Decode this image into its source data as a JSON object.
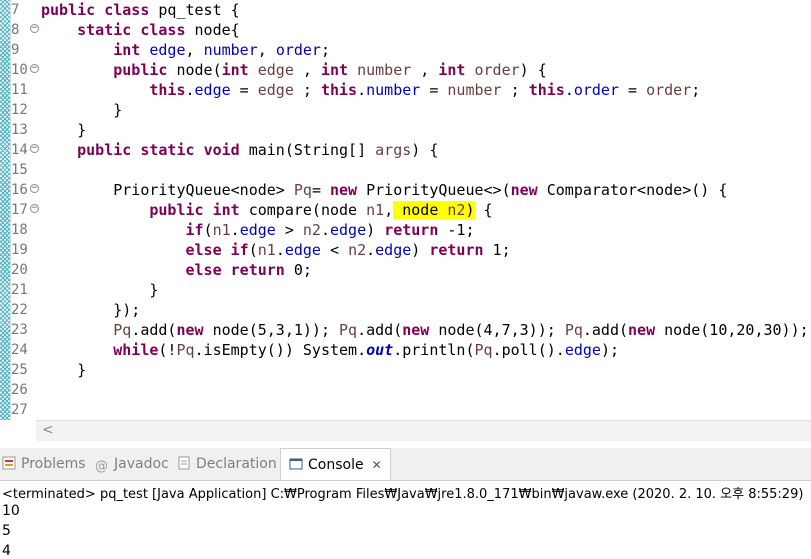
{
  "editor": {
    "lines": [
      {
        "num": "7",
        "fold": "",
        "html": "<span class=\"kw\">public</span> <span class=\"kw\">class</span> pq_test {"
      },
      {
        "num": "8",
        "fold": "⊖",
        "html": "    <span class=\"kw\">static</span> <span class=\"kw\">class</span> node{"
      },
      {
        "num": "9",
        "fold": "",
        "html": "        <span class=\"kw\">int</span> <span class=\"fld\">edge</span>, <span class=\"fld\">number</span>, <span class=\"fld\">order</span>;"
      },
      {
        "num": "10",
        "fold": "⊖",
        "html": "        <span class=\"kw\">public</span> node(<span class=\"kw\">int</span> <span class=\"param\">edge</span> , <span class=\"kw\">int</span> <span class=\"param\">number</span> , <span class=\"kw\">int</span> <span class=\"param\">order</span>) {"
      },
      {
        "num": "11",
        "fold": "",
        "html": "            <span class=\"kw\">this</span>.<span class=\"fld\">edge</span> = <span class=\"param\">edge</span> ; <span class=\"kw\">this</span>.<span class=\"fld\">number</span> = <span class=\"param\">number</span> ; <span class=\"kw\">this</span>.<span class=\"fld\">order</span> = <span class=\"param\">order</span>;"
      },
      {
        "num": "12",
        "fold": "",
        "html": "        }"
      },
      {
        "num": "13",
        "fold": "",
        "html": "    }"
      },
      {
        "num": "14",
        "fold": "⊖",
        "html": "    <span class=\"kw\">public</span> <span class=\"kw\">static</span> <span class=\"kw\">void</span> main(String[] <span class=\"param\">args</span>) {"
      },
      {
        "num": "15",
        "fold": "",
        "html": ""
      },
      {
        "num": "16",
        "fold": "⊖",
        "html": "        PriorityQueue&lt;node&gt; <span class=\"param\">Pq</span>= <span class=\"kw\">new</span> PriorityQueue&lt;&gt;(<span class=\"kw\">new</span> Comparator&lt;node&gt;() {"
      },
      {
        "num": "17",
        "fold": "⊖",
        "html": "            <span class=\"kw\">public</span> <span class=\"kw\">int</span> compare(node <span class=\"param\">n1</span>,<span class=\"hl\"> node <span class=\"param\">n2</span>)</span> {"
      },
      {
        "num": "18",
        "fold": "",
        "html": "                <span class=\"kw\">if</span>(<span class=\"param\">n1</span>.<span class=\"fld\">edge</span> &gt; <span class=\"param\">n2</span>.<span class=\"fld\">edge</span>) <span class=\"kw\">return</span> -1;"
      },
      {
        "num": "19",
        "fold": "",
        "html": "                <span class=\"kw\">else</span> <span class=\"kw\">if</span>(<span class=\"param\">n1</span>.<span class=\"fld\">edge</span> &lt; <span class=\"param\">n2</span>.<span class=\"fld\">edge</span>) <span class=\"kw\">return</span> 1;"
      },
      {
        "num": "20",
        "fold": "",
        "html": "                <span class=\"kw\">else</span> <span class=\"kw\">return</span> 0;"
      },
      {
        "num": "21",
        "fold": "",
        "html": "            }"
      },
      {
        "num": "22",
        "fold": "",
        "html": "        });"
      },
      {
        "num": "23",
        "fold": "",
        "html": "        <span class=\"param\">Pq</span>.add(<span class=\"kw\">new</span> node(5,3,1)); <span class=\"param\">Pq</span>.add(<span class=\"kw\">new</span> node(4,7,3)); <span class=\"param\">Pq</span>.add(<span class=\"kw\">new</span> node(10,20,30));"
      },
      {
        "num": "24",
        "fold": "",
        "html": "        <span class=\"kw\">while</span>(!<span class=\"param\">Pq</span>.isEmpty()) System.<span class=\"stat\">out</span>.println(<span class=\"param\">Pq</span>.poll().<span class=\"fld\">edge</span>);"
      },
      {
        "num": "25",
        "fold": "",
        "html": "    }"
      },
      {
        "num": "26",
        "fold": "",
        "html": ""
      },
      {
        "num": "27",
        "fold": "",
        "html": ""
      }
    ]
  },
  "tabs": [
    {
      "label": "Problems",
      "icon": "problems-icon",
      "active": false
    },
    {
      "label": "Javadoc",
      "icon": "javadoc-icon",
      "active": false
    },
    {
      "label": "Declaration",
      "icon": "declaration-icon",
      "active": false
    },
    {
      "label": "Console",
      "icon": "console-icon",
      "active": true,
      "close": "✕"
    }
  ],
  "console": {
    "status": "<terminated> pq_test [Java Application] C:₩Program Files₩Java₩jre1.8.0_171₩bin₩javaw.exe (2020. 2. 10. 오후 8:55:29)",
    "output": [
      "10",
      "5",
      "4"
    ]
  },
  "colors": {
    "keyword": "#7f0055",
    "field": "#0000c0",
    "param": "#6a3e3e",
    "highlight": "#ffff00"
  }
}
